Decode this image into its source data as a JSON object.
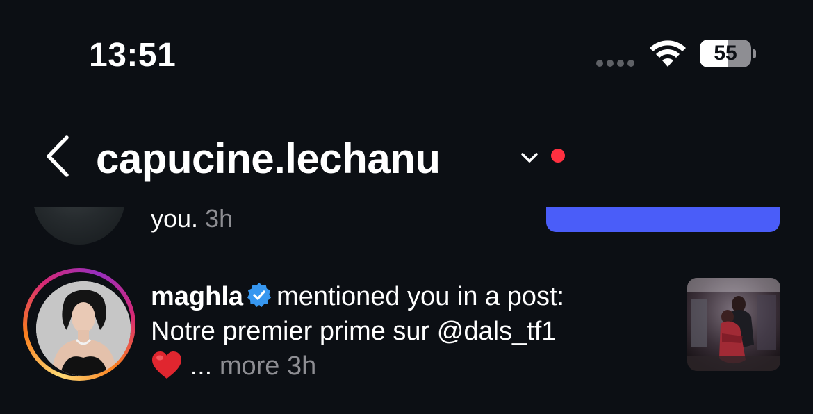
{
  "status_bar": {
    "time": "13:51",
    "battery_level": "55",
    "battery_fraction": 0.55,
    "signal_icon": "cellular-dots-icon",
    "wifi_icon": "wifi-icon"
  },
  "header": {
    "account_name": "capucine.lechanu",
    "back_icon": "chevron-left-icon",
    "switch_icon": "chevron-down-icon",
    "unread_color": "#ff3040"
  },
  "previous_notification": {
    "text_tail": "you.",
    "time": "3h",
    "button_color": "#4a5df9"
  },
  "notification": {
    "username": "maghla",
    "verified": true,
    "action": "mentioned you in a post:",
    "caption": "Notre premier prime sur @dals_tf1",
    "emoji": "❤️",
    "ellipsis": "...",
    "more_label": "more",
    "time": "3h"
  },
  "colors": {
    "background": "#0c0f14",
    "accent_blue": "#4a5df9",
    "verified_blue": "#3797f0",
    "secondary_text": "#8e8e93"
  }
}
